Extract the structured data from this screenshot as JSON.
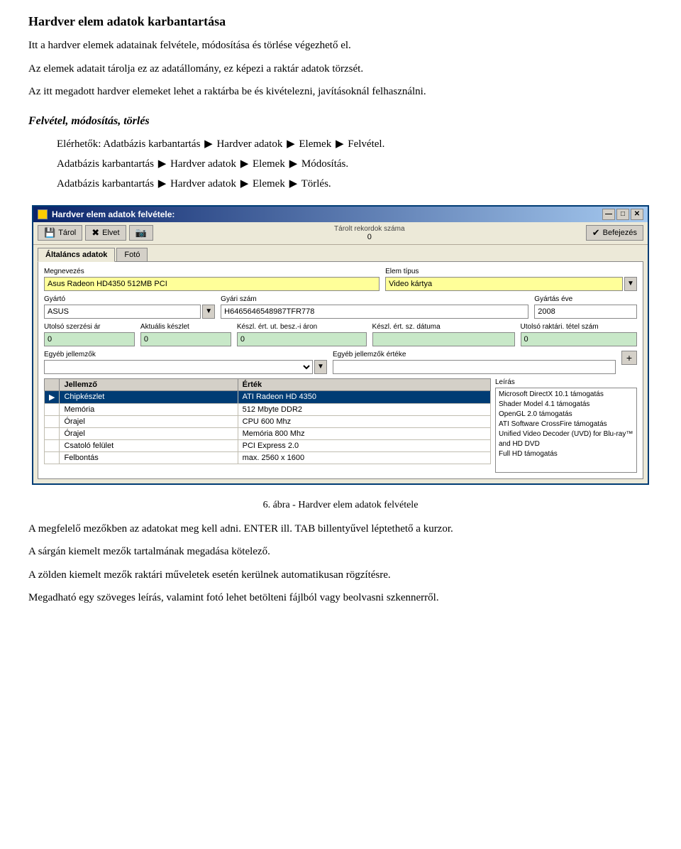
{
  "page": {
    "title": "Hardver elem adatok karbantartása",
    "intro1": "Itt a hardver elemek adatainak felvétele, módosítása és törlése végezhető el.",
    "intro2": "Az elemek adatait tárolja ez az adatállomány, ez képezi a raktár adatok törzsét.",
    "intro3": "Az itt megadott hardver elemeket lehet a raktárba be és kivételezni, javításoknál felhasználni.",
    "section_title": "Felvétel, módosítás, törlés",
    "nav_prefix": "Elérhetők: Adatbázis karbantartás",
    "nav1": "Adatbázis karbantartás ▶ Hardver adatok ▶ Elemek ▶ Felvétel.",
    "nav2": "Adatbázis karbantartás ▶ Hardver adatok ▶ Elemek ▶ Módosítás.",
    "nav3": "Adatbázis karbantartás ▶ Hardver adatok ▶ Elemek ▶ Törlés.",
    "nav1_label": "Elérhetők: Adatbázis karbantartás",
    "nav1_suffix": "Hardver adatok",
    "nav1_suffix2": "Elemek",
    "nav1_suffix3": "Felvétel.",
    "nav2_prefix": "Adatbázis karbantartás",
    "nav2_suffix": "Hardver adatok",
    "nav2_suffix2": "Elemek",
    "nav2_suffix3": "Módosítás.",
    "nav3_prefix": "Adatbázis karbantartás",
    "nav3_suffix": "Hardver adatok",
    "nav3_suffix2": "Elemek",
    "nav3_suffix3": "Törlés.",
    "figure_caption": "6. ábra - Hardver elem adatok felvétele",
    "para1": "A megfelelő mezőkben az adatokat meg kell adni. ENTER ill. TAB billentyűvel léptethető a kurzor.",
    "para2": "A sárgán kiemelt mezők tartalmának megadása kötelező.",
    "para3": "A zölden kiemelt mezők raktári műveletek esetén kerülnek automatikusan rögzítésre.",
    "para4": "Megadható egy szöveges leírás, valamint fotó lehet betölteni fájlból vagy beolvasni szkennerről."
  },
  "dialog": {
    "title": "Hardver elem adatok felvétele:",
    "toolbar": {
      "btn1_icon": "💾",
      "btn1_label": "Tárol",
      "btn2_icon": "✖",
      "btn2_label": "Elvet",
      "btn3_icon": "📷",
      "stored_label": "Tárolt rekordok száma",
      "stored_value": "0",
      "btn_finish_icon": "✔",
      "btn_finish_label": "Befejezés"
    },
    "tabs": [
      "Általáncs adatok",
      "Fotó"
    ],
    "active_tab": 0,
    "form": {
      "megnevezes_label": "Megnevezés",
      "megnevezes_value": "Asus Radeon HD4350 512MB PCI",
      "elem_tipus_label": "Elem típus",
      "elem_tipus_value": "Video kártya",
      "gyarto_label": "Gyártó",
      "gyarto_value": "ASUS",
      "gyari_szam_label": "Gyári szám",
      "gyari_szam_value": "H6465646548987TFR778",
      "gyartas_eve_label": "Gyártás éve",
      "gyartas_eve_value": "2008",
      "utolso_szerz_ar_label": "Utolsó szerzési ár",
      "utolso_szerz_ar_value": "0",
      "aktualis_keszlet_label": "Aktuális készlet",
      "aktualis_keszlet_value": "0",
      "kesz_ert_ut_besz_label": "Készl. ért. ut. besz.-i áron",
      "kesz_ert_ut_besz_value": "0",
      "kesz_ert_sz_datum_label": "Készl. ért. sz. dátuma",
      "kesz_ert_sz_datum_value": "",
      "utolso_raktari_label": "Utolsó raktári. tétel szám",
      "utolso_raktari_value": "0",
      "egyeb_jell_label": "Egyéb jellemzők",
      "egyeb_jell_value": "",
      "egyeb_jell_ertek_label": "Egyéb jellemzők értéke",
      "egyeb_jell_ertek_value": "",
      "leiras_label": "Leírás",
      "leiras_lines": [
        "Microsoft DirectX 10.1 támogatás",
        "Shader Model 4.1 támogatás",
        "OpenGL 2.0 támogatás",
        "ATI Software CrossFire támogatás",
        "Unified Video Decoder (UVD) for Blu-ray™ and HD DVD",
        "Full HD támogatás"
      ],
      "table_headers": [
        "Jellemző",
        "Érték"
      ],
      "table_rows": [
        {
          "arrow": "▶",
          "jellemzo": "Chipkészlet",
          "ertek": "ATI Radeon HD 4350",
          "selected": true
        },
        {
          "arrow": "",
          "jellemzo": "Memória",
          "ertek": "512 Mbyte DDR2",
          "selected": false
        },
        {
          "arrow": "",
          "jellemzo": "Órajel",
          "ertek": "CPU 600 Mhz",
          "selected": false
        },
        {
          "arrow": "",
          "jellemzo": "Órajel",
          "ertek": "Memória 800 Mhz",
          "selected": false
        },
        {
          "arrow": "",
          "jellemzo": "Csatoló felület",
          "ertek": "PCI Express 2.0",
          "selected": false
        },
        {
          "arrow": "",
          "jellemzo": "Felbontás",
          "ertek": "max. 2560 x 1600",
          "selected": false
        }
      ]
    },
    "close_btn": "✕",
    "min_btn": "—",
    "max_btn": "□"
  }
}
